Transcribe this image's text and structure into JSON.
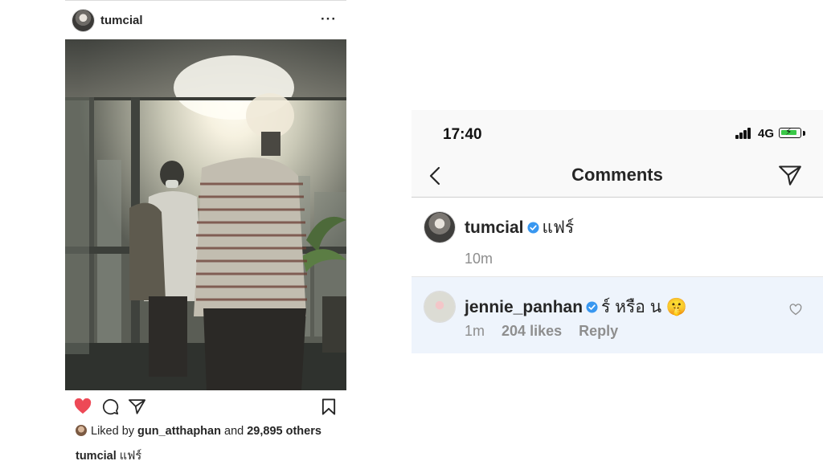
{
  "post": {
    "username": "tumcial",
    "more_icon": "more-icon",
    "liked_by_prefix": "Liked by",
    "liked_by_user": "gun_atthaphan",
    "liked_by_and": "and",
    "liked_by_others": "29,895 others",
    "caption_user": "tumcial",
    "caption_text": "แฟร์",
    "like_color": "#ed4956"
  },
  "comments_screen": {
    "status": {
      "time": "17:40",
      "network": "4G",
      "battery_color": "#3ac947"
    },
    "nav": {
      "title": "Comments",
      "back_icon": "chevron-left-icon",
      "share_icon": "direct-send-icon"
    },
    "caption_comment": {
      "username": "tumcial",
      "text": "แฟร์",
      "time": "10m"
    },
    "reply_comment": {
      "username": "jennie_panhan",
      "text": "ร์ หรือ น 🤫",
      "time": "1m",
      "likes": "204 likes",
      "reply_label": "Reply"
    },
    "verified_color": "#3897f0",
    "reply_highlight_color": "#eef4fc"
  }
}
